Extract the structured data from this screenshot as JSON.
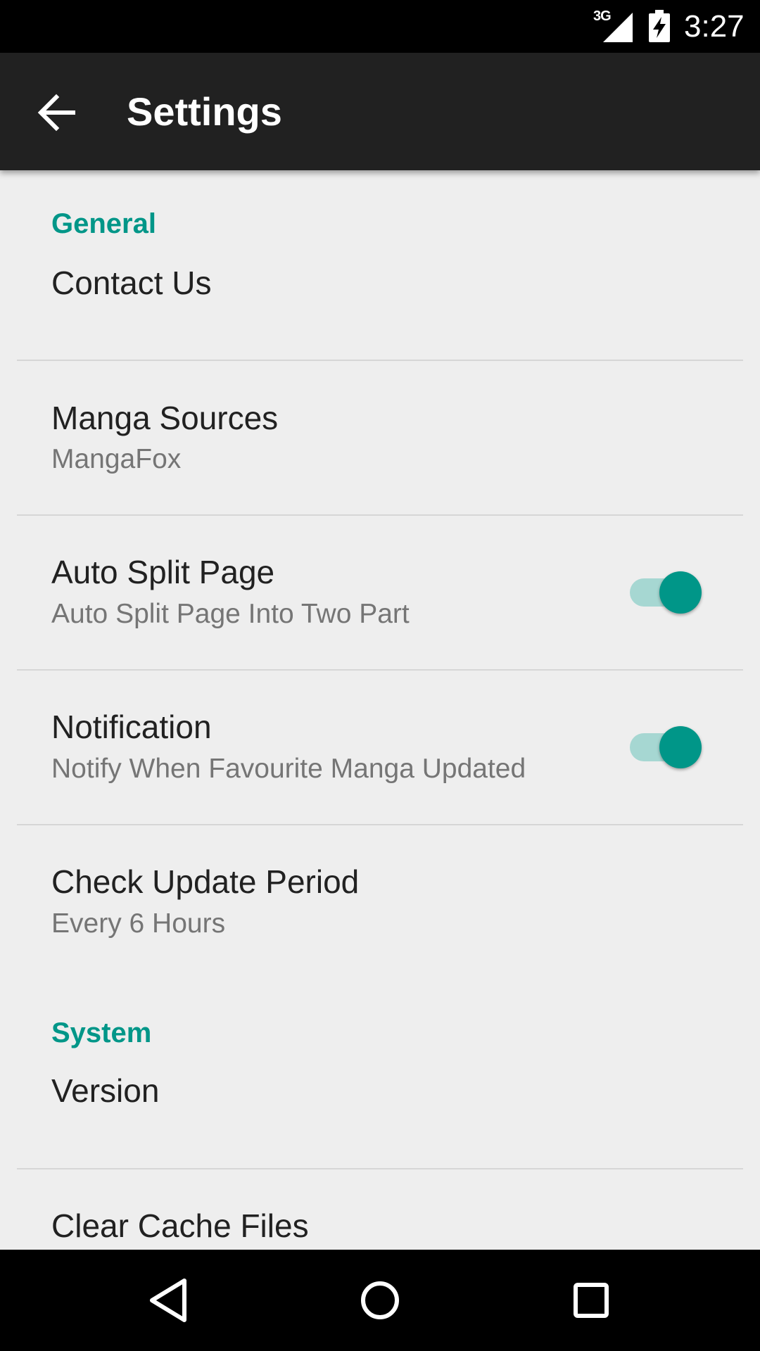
{
  "status_bar": {
    "network_label": "3G",
    "time": "3:27",
    "icons": [
      "signal-icon",
      "battery-charging-icon"
    ]
  },
  "app_bar": {
    "back_icon": "arrow-back-icon",
    "title": "Settings"
  },
  "sections": {
    "general": {
      "header": "General",
      "contact_us": {
        "title": "Contact Us"
      },
      "manga_sources": {
        "title": "Manga Sources",
        "summary": "MangaFox"
      },
      "auto_split_page": {
        "title": "Auto Split Page",
        "summary": "Auto Split Page Into Two Part",
        "enabled": true
      },
      "notification": {
        "title": "Notification",
        "summary": "Notify When Favourite Manga Updated",
        "enabled": true
      },
      "check_update_period": {
        "title": "Check Update Period",
        "summary": "Every 6 Hours"
      }
    },
    "system": {
      "header": "System",
      "version": {
        "title": "Version"
      },
      "clear_cache": {
        "title": "Clear Cache Files"
      }
    }
  },
  "nav_bar": {
    "icons": [
      "back-triangle-icon",
      "home-circle-icon",
      "recents-square-icon"
    ]
  },
  "colors": {
    "accent": "#009688",
    "switch_track": "#a6d7d2",
    "app_bar": "#212121",
    "background": "#eeeeee",
    "status_bar": "#000000"
  }
}
